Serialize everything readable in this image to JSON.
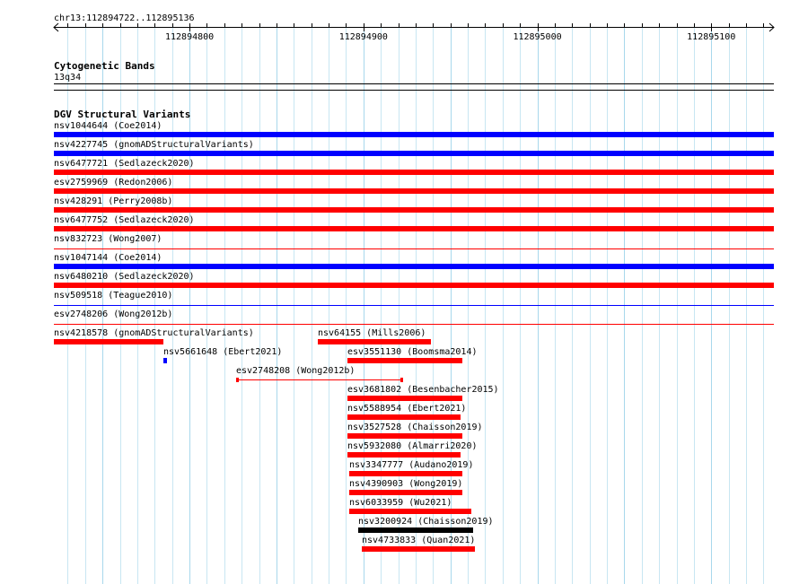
{
  "locus": "chr13:112894722..112895136",
  "ruler": {
    "start": 112894722,
    "end": 112895136,
    "ticks": [
      "112894800",
      "112894900",
      "112895000",
      "112895100"
    ]
  },
  "cytoband": {
    "title": "Cytogenetic Bands",
    "label": "13q34"
  },
  "dgv": {
    "title": "DGV Structural Variants",
    "colors": {
      "loss": "#ff0000",
      "gain": "#0000ff",
      "complex": "#000000"
    },
    "full_rows": [
      {
        "label": "nsv1044644 (Coe2014)",
        "color": "blue",
        "thick": true
      },
      {
        "label": "nsv4227745 (gnomADStructuralVariants)",
        "color": "blue",
        "thick": true
      },
      {
        "label": "nsv6477721 (Sedlazeck2020)",
        "color": "red",
        "thick": true
      },
      {
        "label": "esv2759969 (Redon2006)",
        "color": "red",
        "thick": true
      },
      {
        "label": "nsv428291 (Perry2008b)",
        "color": "red",
        "thick": true
      },
      {
        "label": "nsv6477752 (Sedlazeck2020)",
        "color": "red",
        "thick": true
      },
      {
        "label": "nsv832723 (Wong2007)",
        "color": "red",
        "thick": false
      },
      {
        "label": "nsv1047144 (Coe2014)",
        "color": "blue",
        "thick": true
      },
      {
        "label": "nsv6480210 (Sedlazeck2020)",
        "color": "red",
        "thick": true
      },
      {
        "label": "nsv509518 (Teague2010)",
        "color": "blue",
        "thick": false
      },
      {
        "label": "esv2748206 (Wong2012b)",
        "color": "red",
        "thick": false
      }
    ],
    "features": [
      {
        "label": "nsv4218578 (gnomADStructuralVariants)",
        "start": 112894722,
        "end": 112894785,
        "color": "red",
        "style": "thick",
        "row": 0
      },
      {
        "label": "nsv64155 (Mills2006)",
        "start": 112894874,
        "end": 112894939,
        "color": "red",
        "style": "thick",
        "row": 0
      },
      {
        "label": "nsv5661648 (Ebert2021)",
        "start": 112894785,
        "end": 112894787,
        "color": "blue",
        "style": "thick",
        "row": 1
      },
      {
        "label": "esv3551130 (Boomsma2014)",
        "start": 112894891,
        "end": 112894957,
        "color": "red",
        "style": "thick",
        "row": 1
      },
      {
        "label": "esv2748208 (Wong2012b)",
        "start": 112894827,
        "end": 112894923,
        "color": "red",
        "style": "thin",
        "row": 2
      },
      {
        "label": "esv3681802 (Besenbacher2015)",
        "start": 112894891,
        "end": 112894957,
        "color": "red",
        "style": "thick",
        "row": 3
      },
      {
        "label": "nsv5588954 (Ebert2021)",
        "start": 112894891,
        "end": 112894956,
        "color": "red",
        "style": "thick",
        "row": 4
      },
      {
        "label": "nsv3527528 (Chaisson2019)",
        "start": 112894891,
        "end": 112894957,
        "color": "red",
        "style": "thick",
        "row": 5
      },
      {
        "label": "nsv5932080 (Almarri2020)",
        "start": 112894891,
        "end": 112894956,
        "color": "red",
        "style": "thick",
        "row": 6
      },
      {
        "label": "nsv3347777 (Audano2019)",
        "start": 112894892,
        "end": 112894957,
        "color": "red",
        "style": "thick",
        "row": 7
      },
      {
        "label": "nsv4390903 (Wong2019)",
        "start": 112894892,
        "end": 112894957,
        "color": "red",
        "style": "thick",
        "row": 8
      },
      {
        "label": "nsv6033959 (Wu2021)",
        "start": 112894892,
        "end": 112894962,
        "color": "red",
        "style": "thick",
        "row": 9
      },
      {
        "label": "nsv3200924 (Chaisson2019)",
        "start": 112894897,
        "end": 112894963,
        "color": "black",
        "style": "thick",
        "row": 10
      },
      {
        "label": "nsv4733833 (Quan2021)",
        "start": 112894899,
        "end": 112894964,
        "color": "red",
        "style": "thick",
        "row": 11
      }
    ]
  }
}
